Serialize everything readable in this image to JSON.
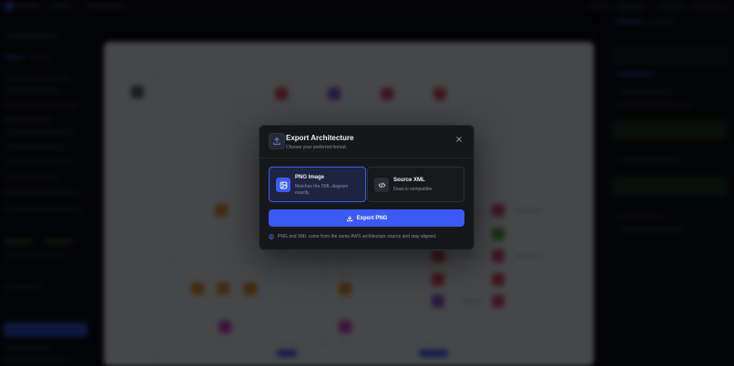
{
  "modal": {
    "title": "Export Architecture",
    "subtitle": "Choose your preferred format.",
    "header_icon": "upload-icon",
    "close_icon": "close-icon"
  },
  "options": [
    {
      "title": "PNG Image",
      "description": "Matches the XML diagram exactly.",
      "icon": "image-icon",
      "selected": true
    },
    {
      "title": "Source XML",
      "description": "Draw.io compatible.",
      "icon": "code-icon",
      "selected": false
    }
  ],
  "export_button": {
    "label": "Export PNG",
    "icon": "download-icon"
  },
  "note": {
    "text": "PNG and XML come from the same AWS architecture source and stay aligned.",
    "icon": "info-icon"
  },
  "colors": {
    "accent": "#3b59f5",
    "modal_bg": "#16171b",
    "overlay": "#050608"
  }
}
